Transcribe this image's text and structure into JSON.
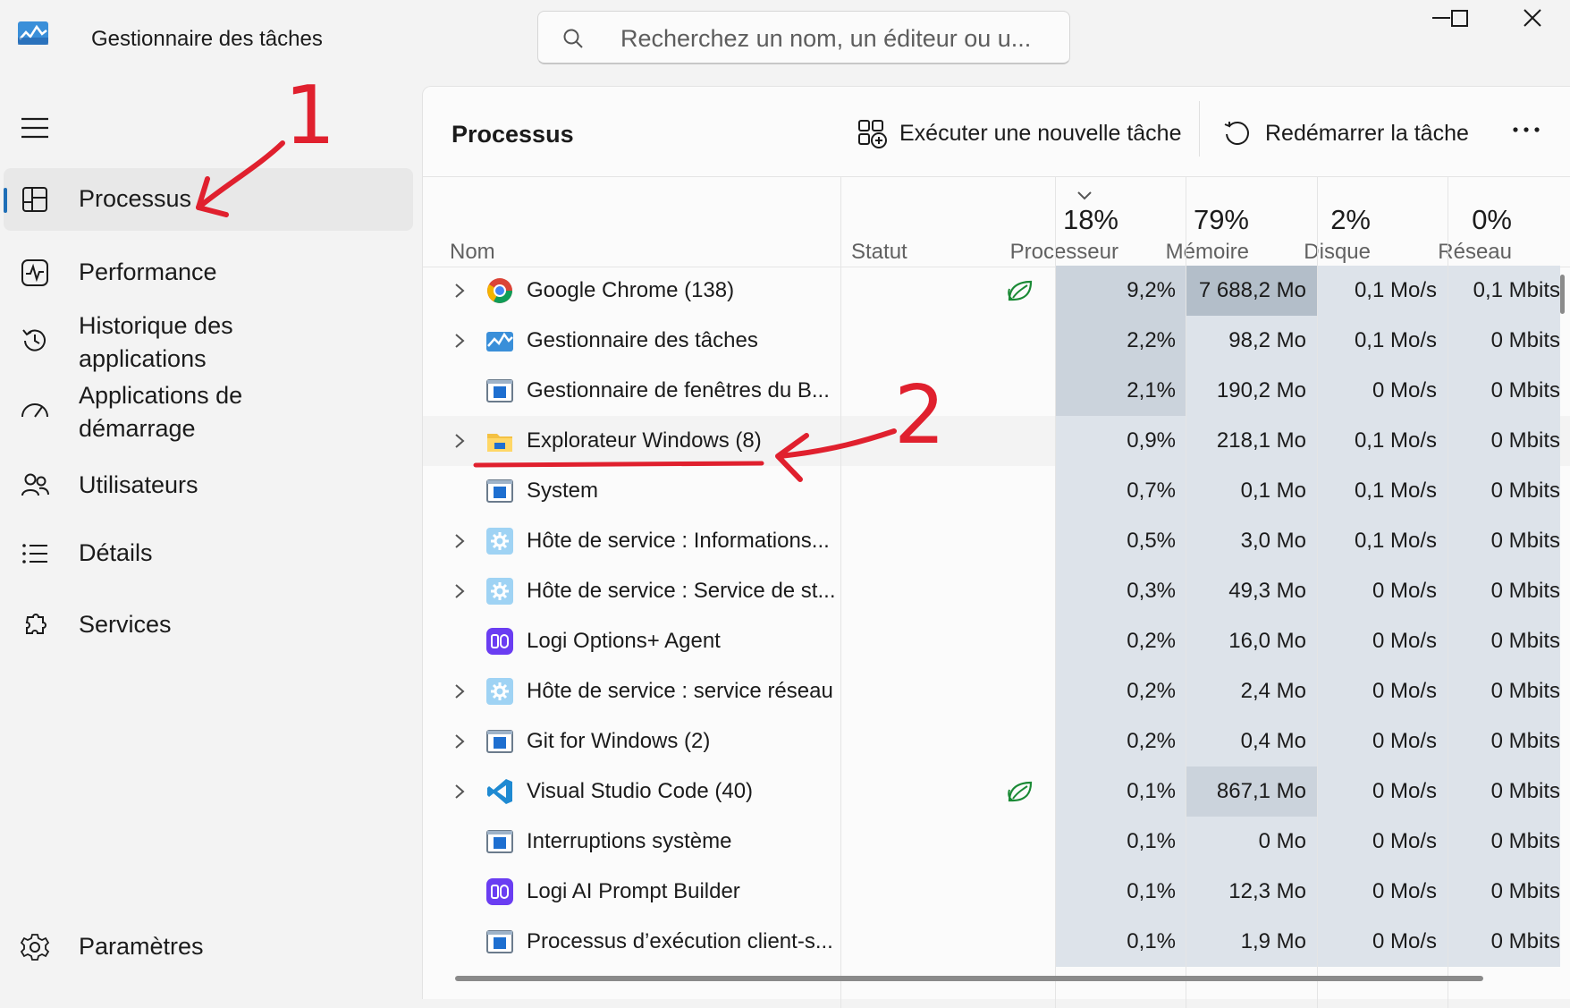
{
  "app": {
    "title": "Gestionnaire des tâches",
    "icon": "task-manager-icon"
  },
  "search": {
    "placeholder": "Recherchez un nom, un éditeur ou u..."
  },
  "sidebar": {
    "items": [
      {
        "label": "Processus",
        "icon": "processes-icon",
        "active": true
      },
      {
        "label": "Performance",
        "icon": "performance-icon"
      },
      {
        "label": "Historique des applications",
        "icon": "history-icon"
      },
      {
        "label": "Applications de démarrage",
        "icon": "startup-icon"
      },
      {
        "label": "Utilisateurs",
        "icon": "users-icon"
      },
      {
        "label": "Détails",
        "icon": "details-icon"
      },
      {
        "label": "Services",
        "icon": "services-icon"
      }
    ],
    "settings_label": "Paramètres"
  },
  "main": {
    "title": "Processus",
    "run_task_label": "Exécuter une nouvelle tâche",
    "restart_task_label": "Redémarrer la tâche"
  },
  "table": {
    "columns": {
      "name": "Nom",
      "status": "Statut",
      "cpu": {
        "pct": "18%",
        "label": "Processeur"
      },
      "memory": {
        "pct": "79%",
        "label": "Mémoire"
      },
      "disk": {
        "pct": "2%",
        "label": "Disque"
      },
      "network": {
        "pct": "0%",
        "label": "Réseau"
      }
    },
    "rows": [
      {
        "name": "Google Chrome (138)",
        "icon": "chrome-icon",
        "expandable": true,
        "eco": true,
        "cpu": "9,2%",
        "memory": "7 688,2 Mo",
        "disk": "0,1 Mo/s",
        "network": "0,1 Mbits"
      },
      {
        "name": "Gestionnaire des tâches",
        "icon": "task-manager-icon",
        "expandable": true,
        "cpu": "2,2%",
        "memory": "98,2 Mo",
        "disk": "0,1 Mo/s",
        "network": "0 Mbits"
      },
      {
        "name": "Gestionnaire de fenêtres du B...",
        "icon": "app-window-icon",
        "cpu": "2,1%",
        "memory": "190,2 Mo",
        "disk": "0 Mo/s",
        "network": "0 Mbits"
      },
      {
        "name": "Explorateur Windows (8)",
        "icon": "folder-icon",
        "expandable": true,
        "cpu": "0,9%",
        "memory": "218,1 Mo",
        "disk": "0,1 Mo/s",
        "network": "0 Mbits"
      },
      {
        "name": "System",
        "icon": "app-window-icon",
        "cpu": "0,7%",
        "memory": "0,1 Mo",
        "disk": "0,1 Mo/s",
        "network": "0 Mbits"
      },
      {
        "name": "Hôte de service : Informations...",
        "icon": "gear-service-icon",
        "expandable": true,
        "cpu": "0,5%",
        "memory": "3,0 Mo",
        "disk": "0,1 Mo/s",
        "network": "0 Mbits"
      },
      {
        "name": "Hôte de service : Service de st...",
        "icon": "gear-service-icon",
        "expandable": true,
        "cpu": "0,3%",
        "memory": "49,3 Mo",
        "disk": "0 Mo/s",
        "network": "0 Mbits"
      },
      {
        "name": "Logi Options+ Agent",
        "icon": "logi-icon",
        "cpu": "0,2%",
        "memory": "16,0 Mo",
        "disk": "0 Mo/s",
        "network": "0 Mbits"
      },
      {
        "name": "Hôte de service : service réseau",
        "icon": "gear-service-icon",
        "expandable": true,
        "cpu": "0,2%",
        "memory": "2,4 Mo",
        "disk": "0 Mo/s",
        "network": "0 Mbits"
      },
      {
        "name": "Git for Windows (2)",
        "icon": "app-window-icon",
        "expandable": true,
        "cpu": "0,2%",
        "memory": "0,4 Mo",
        "disk": "0 Mo/s",
        "network": "0 Mbits"
      },
      {
        "name": "Visual Studio Code (40)",
        "icon": "vscode-icon",
        "expandable": true,
        "eco": true,
        "cpu": "0,1%",
        "memory": "867,1 Mo",
        "disk": "0 Mo/s",
        "network": "0 Mbits"
      },
      {
        "name": "Interruptions système",
        "icon": "app-window-icon",
        "cpu": "0,1%",
        "memory": "0 Mo",
        "disk": "0 Mo/s",
        "network": "0 Mbits"
      },
      {
        "name": "Logi AI Prompt Builder",
        "icon": "logi-icon",
        "cpu": "0,1%",
        "memory": "12,3 Mo",
        "disk": "0 Mo/s",
        "network": "0 Mbits"
      },
      {
        "name": "Processus d’exécution client-s...",
        "icon": "app-window-icon",
        "cpu": "0,1%",
        "memory": "1,9 Mo",
        "disk": "0 Mo/s",
        "network": "0 Mbits"
      }
    ]
  },
  "annotations": {
    "label_1": "1",
    "label_2": "2",
    "color": "#e0202e"
  },
  "colors": {
    "accent": "#1f6fb7",
    "heat_light": "#dde3ea",
    "heat_mid": "#cbd3dc",
    "heat_strong": "#b3bec9"
  }
}
